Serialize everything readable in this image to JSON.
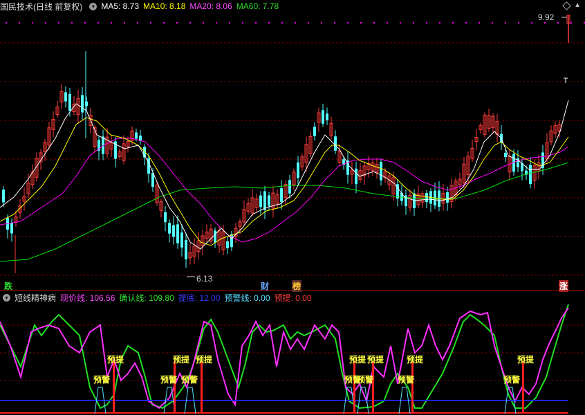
{
  "main_header": {
    "title": "国民技术(日线 前复权)",
    "ma5": "MA5: 8.73",
    "ma10": "MA10: 8.18",
    "ma20": "MA20: 8.06",
    "ma60": "MA60: 7.78"
  },
  "price_labels": {
    "high": "9.92",
    "low": "6.13"
  },
  "markers": {
    "left": "跌",
    "cai": "财",
    "bang": "榜",
    "right": "涨"
  },
  "indicator_header": {
    "title": "短线精神病",
    "xianjia": "现价线: 106.56",
    "queren": "确认线: 109.80",
    "didi": "提底: 12.00",
    "yujing": "预警线: 0.00",
    "yuti": "预提: 0.00"
  },
  "signal_labels": {
    "yuti": "预提",
    "yujing": "预警"
  },
  "colors": {
    "up": "#ff3c3c",
    "down": "#54ffff",
    "ma5": "#ffffff",
    "ma10": "#ffff00",
    "ma20": "#ff00ff",
    "ma60": "#00e000",
    "blue": "#2020ff"
  }
}
